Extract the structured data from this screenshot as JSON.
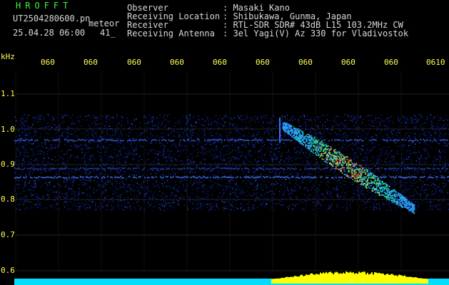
{
  "header": {
    "brand": "HROFFT",
    "file": "UT2504280600.pn",
    "mode": "meteor",
    "datetime": "25.04.28 06:00",
    "count": "41_",
    "fields": [
      {
        "label": "Observer",
        "value": ": Masaki Kano"
      },
      {
        "label": "Receiving Location",
        "value": ": Shibukawa, Gunma, Japan"
      },
      {
        "label": "Receiver",
        "value": ": RTL-SDR SDR# 43dB L15 103.2MHz CW"
      },
      {
        "label": "Receiving Antenna",
        "value": ": 3el Yagi(V) Az 330 for Vladivostok"
      }
    ]
  },
  "spectrogram": {
    "y_unit": "kHz",
    "y_ticks": [
      "1.1",
      "1.0",
      "0.9",
      "0.8",
      "0.7",
      "0.6"
    ],
    "x_ticks": [
      "060",
      "060",
      "060",
      "060",
      "060",
      "060",
      "060",
      "060",
      "060",
      "0610"
    ],
    "colors": {
      "label": "#ffff55",
      "grid": "#444444",
      "baseline": "#00ddff",
      "peak": "#ffff00"
    }
  }
}
